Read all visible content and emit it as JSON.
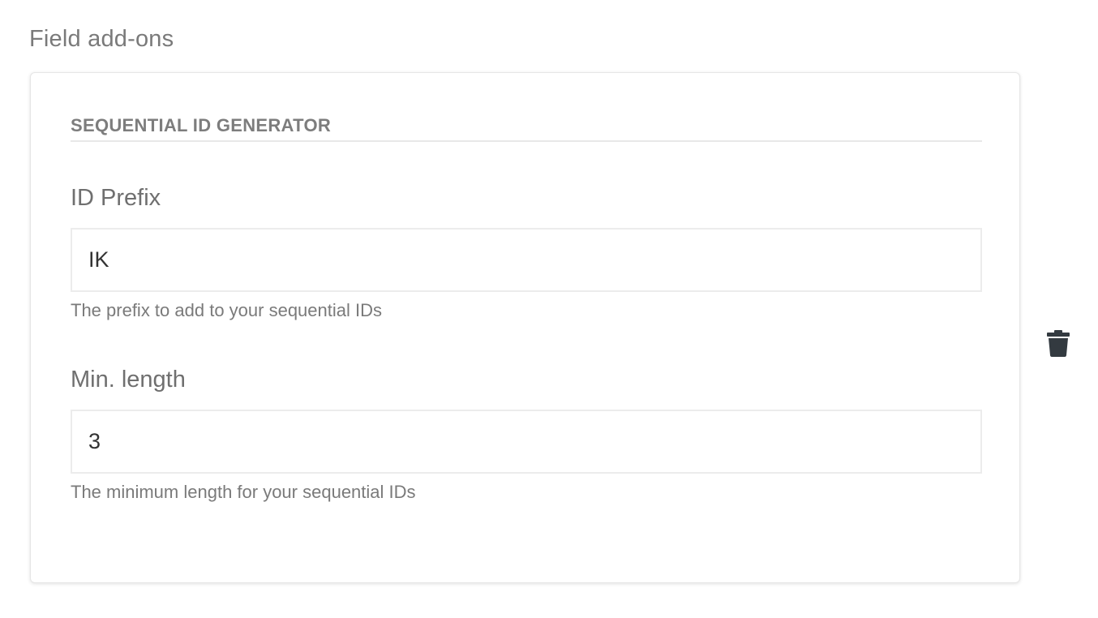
{
  "section": {
    "title": "Field add-ons"
  },
  "addon": {
    "heading": "SEQUENTIAL ID GENERATOR",
    "fields": [
      {
        "label": "ID Prefix",
        "value": "IK",
        "help": "The prefix to add to your sequential IDs"
      },
      {
        "label": "Min. length",
        "value": "3",
        "help": "The minimum length for your sequential IDs"
      }
    ],
    "delete_icon": "trash-icon"
  },
  "colors": {
    "label_text": "#6f6f6f",
    "heading_text": "#7d7d7d",
    "input_border": "#ececec",
    "icon": "#333a40"
  }
}
